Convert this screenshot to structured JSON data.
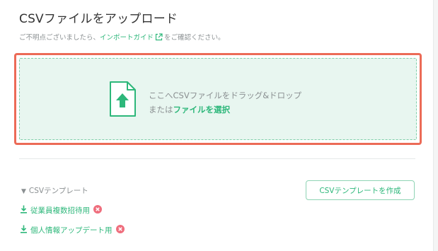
{
  "page": {
    "title": "CSVファイルをアップロード",
    "note_prefix": "ご不明点ございましたら、",
    "note_link": "インポートガイド",
    "note_suffix": "をご確認ください。"
  },
  "dropzone": {
    "instruction": "ここへCSVファイルをドラッグ&ドロップ",
    "or_text": "または",
    "select_link": "ファイルを選択"
  },
  "templates": {
    "toggle_label": "CSVテンプレート",
    "create_button": "CSVテンプレートを作成",
    "items": [
      {
        "label": "従業員複数招待用"
      },
      {
        "label": "個人情報アップデート用"
      }
    ]
  },
  "colors": {
    "accent": "#2db77a",
    "highlight": "#ec6b57",
    "delete": "#ef6e7d",
    "dropzone_bg": "#e8f6f0"
  }
}
